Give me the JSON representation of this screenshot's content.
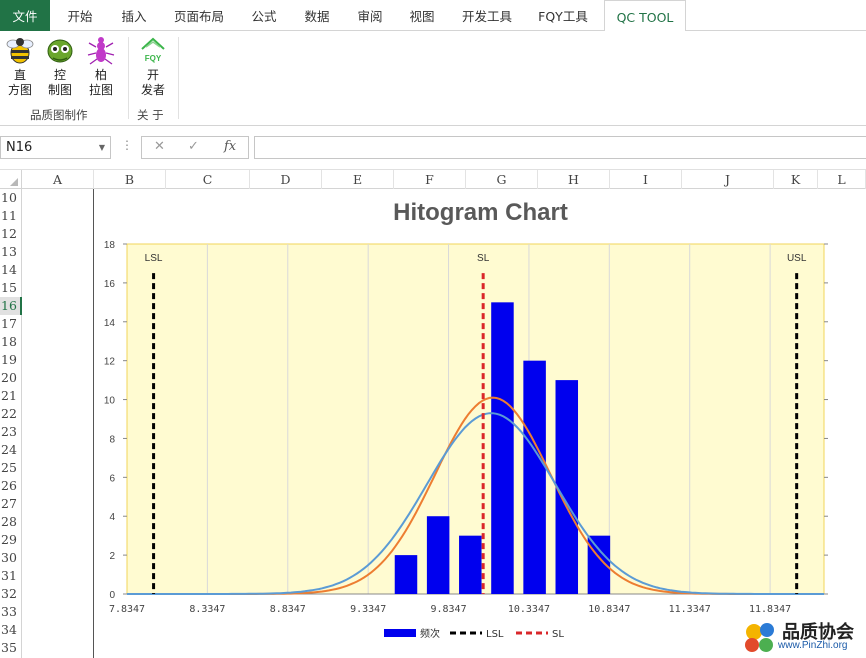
{
  "ribbon": {
    "tabs": [
      "文件",
      "开始",
      "插入",
      "页面布局",
      "公式",
      "数据",
      "审阅",
      "视图",
      "开发工具",
      "FQY工具",
      "QC TOOL"
    ],
    "active_tab": "QC TOOL",
    "groups": [
      {
        "label": "品质图制作",
        "buttons": [
          {
            "line1": "直",
            "line2": "方图",
            "icon": "bee-icon"
          },
          {
            "line1": "控",
            "line2": "制图",
            "icon": "bug-icon"
          },
          {
            "line1": "柏",
            "line2": "拉图",
            "icon": "ant-icon"
          }
        ]
      },
      {
        "label": "关 于",
        "buttons": [
          {
            "line1": "开",
            "line2": "发者",
            "icon": "fqy-house-icon"
          }
        ]
      }
    ]
  },
  "formula_bar": {
    "name_box": "N16",
    "formula": ""
  },
  "sheet": {
    "columns": [
      "A",
      "B",
      "C",
      "D",
      "E",
      "F",
      "G",
      "H",
      "I",
      "J",
      "K",
      "L"
    ],
    "rows": [
      "10",
      "11",
      "12",
      "13",
      "14",
      "15",
      "16",
      "17",
      "18",
      "19",
      "20",
      "21",
      "22",
      "23",
      "24",
      "25",
      "26",
      "27",
      "28",
      "29",
      "30",
      "31",
      "32",
      "33",
      "34",
      "35"
    ],
    "selected_row": "16"
  },
  "chart_data": {
    "type": "bar",
    "title": "Hitogram Chart",
    "x_ticks": [
      "7.8347",
      "8.3347",
      "8.8347",
      "9.3347",
      "9.8347",
      "10.3347",
      "10.8347",
      "11.3347",
      "11.8347"
    ],
    "ylim": [
      0,
      18
    ],
    "y_ticks": [
      "0",
      "2",
      "4",
      "6",
      "8",
      "10",
      "12",
      "14",
      "16",
      "18"
    ],
    "bars": [
      {
        "x": 9.57,
        "value": 2
      },
      {
        "x": 9.77,
        "value": 4
      },
      {
        "x": 9.97,
        "value": 3
      },
      {
        "x": 10.17,
        "value": 15
      },
      {
        "x": 10.37,
        "value": 12
      },
      {
        "x": 10.57,
        "value": 11
      },
      {
        "x": 10.77,
        "value": 3
      }
    ],
    "bar_width": 0.14,
    "limits": [
      {
        "name": "LSL",
        "x": 8.0,
        "label": "LSL",
        "color": "#000000"
      },
      {
        "name": "SL",
        "x": 10.05,
        "label": "SL",
        "color": "#d9262a"
      },
      {
        "name": "USL",
        "x": 12.0,
        "label": "USL",
        "color": "#000000"
      }
    ],
    "limit_top": 16.5,
    "curves": [
      {
        "mean": 10.11,
        "sd": 0.36,
        "peak": 10.1,
        "color": "#ed7d31"
      },
      {
        "mean": 10.1,
        "sd": 0.4,
        "peak": 9.3,
        "color": "#5b9bd5"
      }
    ],
    "xlim": [
      7.8347,
      12.17
    ],
    "plot_bg": "#fffbd1",
    "bar_color": "#0000ee",
    "legend": [
      {
        "label": "频次",
        "kind": "bar",
        "color": "#0000ee"
      },
      {
        "label": "LSL",
        "kind": "dash",
        "color": "#000000"
      },
      {
        "label": "SL",
        "kind": "dash",
        "color": "#d9262a"
      }
    ]
  },
  "watermark": {
    "cn": "品质协会",
    "url": "www.PinZhi.org"
  }
}
